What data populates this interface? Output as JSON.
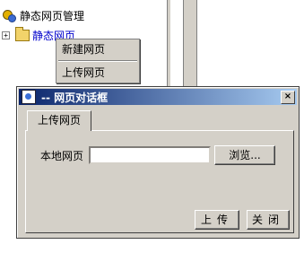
{
  "tree": {
    "root_label": "静态网页管理",
    "root_icon": "gear-icon",
    "child_expander": "+",
    "child_label": "静态网页",
    "child_icon": "folder-icon"
  },
  "context_menu": {
    "items": [
      "新建网页",
      "上传网页"
    ]
  },
  "dialog": {
    "title": "-- 网页对话框",
    "close_symbol": "×",
    "tab_label": "上传网页",
    "field_label": "本地网页",
    "file_value": "",
    "browse_label": "浏览...",
    "upload_label": "上传",
    "close_label": "关闭"
  },
  "colors": {
    "titlebar_start": "#0a246a",
    "titlebar_end": "#a6caf0",
    "face": "#d4d0c8",
    "link": "#0000cc"
  }
}
